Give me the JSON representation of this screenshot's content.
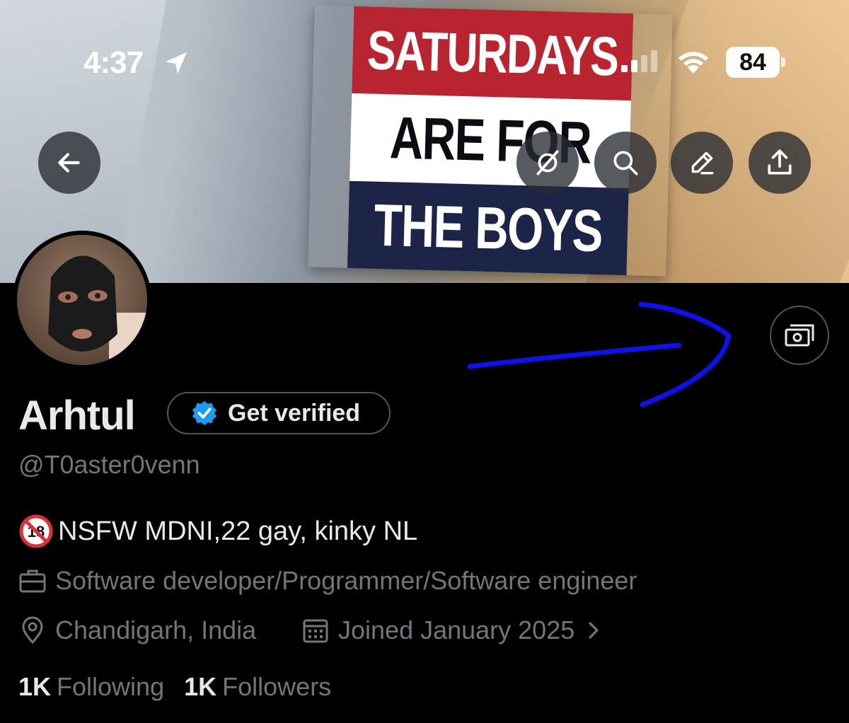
{
  "status_bar": {
    "time": "4:37",
    "battery": "84"
  },
  "banner": {
    "flag_lines": [
      "SATURDAYS",
      "ARE FOR",
      "THE BOYS"
    ]
  },
  "icons": {
    "back": "arrow-left-icon",
    "grok": "grok-icon",
    "search": "search-icon",
    "edit": "pencil-icon",
    "share": "share-icon",
    "money": "money-icon"
  },
  "profile": {
    "display_name": "Arhtul",
    "verify_label": "Get verified",
    "handle": "@T0aster0venn",
    "bio_text": "NSFW MDNI,22 gay, kinky NL",
    "profession": "Software developer/Programmer/Software engineer",
    "location": "Chandigarh, India",
    "joined": "Joined January 2025",
    "following_count": "1K",
    "following_label": "Following",
    "followers_count": "1K",
    "followers_label": "Followers"
  },
  "colors": {
    "verified_blue": "#1d9bf0",
    "annotation": "#1010e8",
    "muted": "#71767b"
  }
}
